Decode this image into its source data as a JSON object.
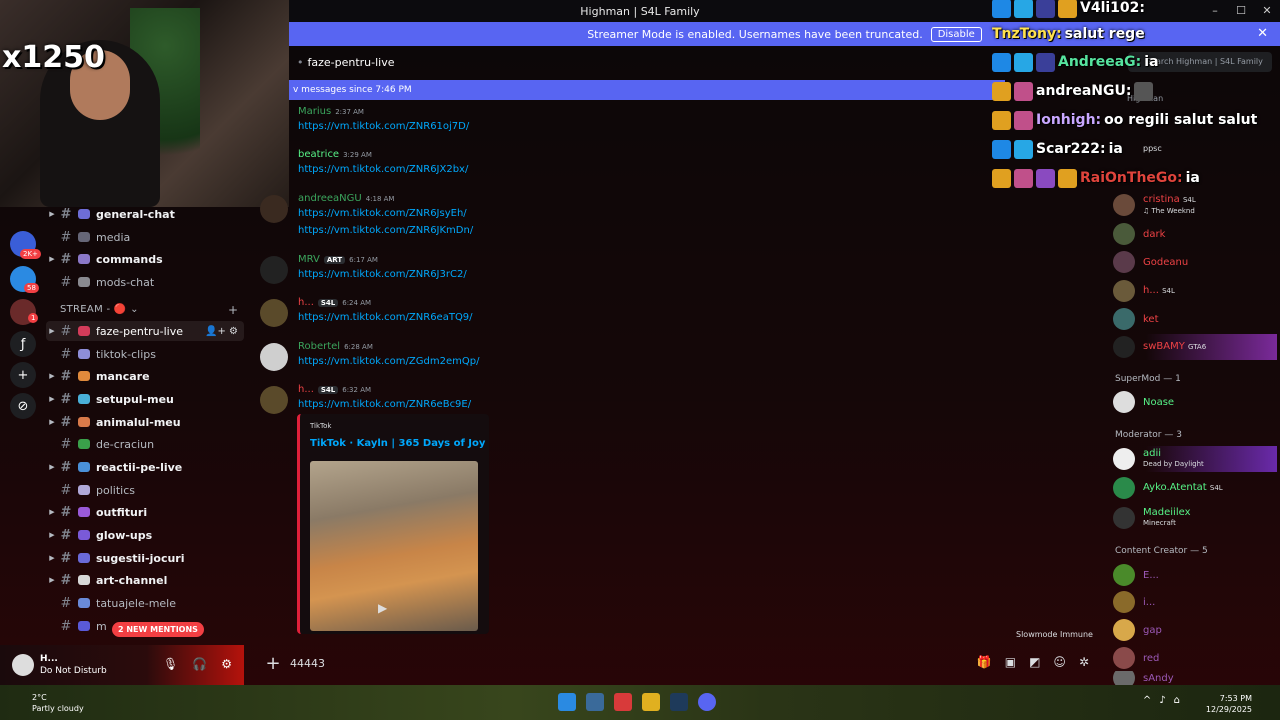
{
  "window": {
    "title": "Highman | S4L Family",
    "controls": [
      "–",
      "☐",
      "✕"
    ]
  },
  "banner": {
    "text": "Streamer Mode is enabled. Usernames have been truncated.",
    "button": "Disable",
    "close": "✕"
  },
  "webcam": {
    "multiplier": "x1250"
  },
  "rail": {
    "badges": [
      "2K+",
      "58",
      "1"
    ]
  },
  "channels": {
    "items_top": [
      {
        "name": "general-chat",
        "bold": true,
        "arrow": true,
        "color": "#6d6dd6"
      },
      {
        "name": "media",
        "bold": false,
        "arrow": false,
        "color": "#666677"
      },
      {
        "name": "commands",
        "bold": true,
        "arrow": true,
        "color": "#8b78c8"
      },
      {
        "name": "mods-chat",
        "bold": false,
        "arrow": false,
        "color": "#8a8a90"
      }
    ],
    "category": "STREAM - 🔴 ⌄",
    "category_plus": "+",
    "items_stream": [
      {
        "name": "faze-pentru-live",
        "bold": false,
        "active": true,
        "arrow": true,
        "color": "#d33c5a"
      },
      {
        "name": "tiktok-clips",
        "bold": false,
        "arrow": false,
        "color": "#8e8ed8"
      },
      {
        "name": "mancare",
        "bold": true,
        "arrow": true,
        "color": "#e08a3c"
      },
      {
        "name": "setupul-meu",
        "bold": true,
        "arrow": true,
        "color": "#4ab0d8"
      },
      {
        "name": "animalul-meu",
        "bold": true,
        "arrow": true,
        "color": "#d87a4a"
      },
      {
        "name": "de-craciun",
        "bold": false,
        "arrow": false,
        "color": "#3aa04a"
      },
      {
        "name": "reactii-pe-live",
        "bold": true,
        "arrow": true,
        "color": "#4a90d8"
      },
      {
        "name": "politics",
        "bold": false,
        "arrow": false,
        "color": "#b0a8d8"
      },
      {
        "name": "outfituri",
        "bold": true,
        "arrow": true,
        "color": "#9a5ad8"
      },
      {
        "name": "glow-ups",
        "bold": true,
        "arrow": true,
        "color": "#7a5ad8"
      },
      {
        "name": "sugestii-jocuri",
        "bold": true,
        "arrow": true,
        "color": "#6a6ad8"
      },
      {
        "name": "art-channel",
        "bold": true,
        "arrow": true,
        "color": "#d8d8d8"
      },
      {
        "name": "tatuajele-mele",
        "bold": false,
        "arrow": false,
        "color": "#6a8ad8"
      },
      {
        "name": "m",
        "bold": false,
        "arrow": false,
        "color": "#5a5ad8"
      }
    ],
    "active_tools": "👤+ ⚙",
    "new_mentions": "2 NEW MENTIONS"
  },
  "user": {
    "name": "H...",
    "status": "Do Not Disturb",
    "controls": [
      "🎙",
      "🎧",
      "⚙"
    ]
  },
  "chat": {
    "channel": "faze-pentru-live",
    "new_messages": "v messages since 7:46 PM",
    "messages": [
      {
        "author": "Marius",
        "color": "#3ba55d",
        "time": "2:37 AM",
        "link": "https://vm.tiktok.com/ZNR61oj7D/",
        "tag": ""
      },
      {
        "author": "beatrice",
        "color": "#57f287",
        "time": "3:29 AM",
        "link": "https://vm.tiktok.com/ZNR6JX2bx/",
        "tag": ""
      },
      {
        "author": "andreeaNGU",
        "color": "#3ba55d",
        "time": "4:18 AM",
        "link": "https://vm.tiktok.com/ZNR6JsyEh/",
        "link2": "https://vm.tiktok.com/ZNR6JKmDn/",
        "tag": ""
      },
      {
        "author": "MRV",
        "color": "#3ba55d",
        "time": "6:17 AM",
        "link": "https://vm.tiktok.com/ZNR6J3rC2/",
        "tag": "ART"
      },
      {
        "author": "h...",
        "color": "#ed4245",
        "time": "6:24 AM",
        "link": "https://vm.tiktok.com/ZNR6eaTQ9/",
        "tag": "S4L"
      },
      {
        "author": "Robertel",
        "color": "#3ba55d",
        "time": "6:28 AM",
        "link": "https://vm.tiktok.com/ZGdm2emQp/",
        "tag": ""
      },
      {
        "author": "h...",
        "color": "#ed4245",
        "time": "6:32 AM",
        "link": "https://vm.tiktok.com/ZNR6eBc9E/",
        "tag": "S4L"
      }
    ],
    "embed": {
      "provider": "TikTok",
      "title": "TikTok · Kayln | 365 Days of Joy"
    },
    "slowmode": "Slowmode Immune",
    "input_value": "44443"
  },
  "search": {
    "placeholder": "Search Highman | S4L Family"
  },
  "members": {
    "top_hidden": "Highman",
    "ppsc": "ppsc",
    "list1": [
      {
        "name": "cristina",
        "sub": "♫ The Weeknd",
        "color": "#ed4245",
        "tag": "S4L"
      },
      {
        "name": "dark",
        "sub": "",
        "color": "#ed4245",
        "tag": ""
      },
      {
        "name": "Godeanu",
        "sub": "",
        "color": "#ed4245",
        "tag": ""
      },
      {
        "name": "h...",
        "sub": "",
        "color": "#ed4245",
        "tag": "S4L"
      },
      {
        "name": "ket",
        "sub": "",
        "color": "#ed4245",
        "tag": ""
      },
      {
        "name": "swBAMY",
        "sub": "",
        "color": "#ed4245",
        "tag": "GTA6"
      }
    ],
    "supermod_label": "SuperMod — 1",
    "supermod": [
      {
        "name": "Noase",
        "sub": "",
        "color": "#57f287",
        "tag": ""
      }
    ],
    "moderator_label": "Moderator — 3",
    "moderators": [
      {
        "name": "adii",
        "sub": "Dead by Daylight",
        "color": "#57f287",
        "tag": ""
      },
      {
        "name": "Ayko.Atentat",
        "sub": "",
        "color": "#57f287",
        "tag": "S4L"
      },
      {
        "name": "Madeiilex",
        "sub": "Minecraft",
        "color": "#57f287",
        "tag": ""
      }
    ],
    "creator_label": "Content Creator — 5",
    "creators": [
      {
        "name": "E...",
        "color": "#9b59b6"
      },
      {
        "name": "i...",
        "color": "#9b59b6"
      },
      {
        "name": "gap",
        "color": "#9b59b6"
      },
      {
        "name": "red",
        "color": "#9b59b6"
      },
      {
        "name": "sAndy",
        "color": "#9b59b6"
      }
    ]
  },
  "overlay": {
    "lines": [
      {
        "name": "V4li102:",
        "msg": "",
        "color": "#ffffff"
      },
      {
        "name": "TnzTony:",
        "msg": "salut rege",
        "color": "#ffe14d"
      },
      {
        "name": "AndreeaG:",
        "msg": "ia",
        "color": "#56e39f"
      },
      {
        "name": "andreaNGU:",
        "msg": "",
        "color": "#ffffff"
      },
      {
        "name": "Ionhigh:",
        "msg": "oo regili salut salut",
        "color": "#c9a7ff"
      },
      {
        "name": "Scar222:",
        "msg": "ia",
        "color": "#ffffff"
      },
      {
        "name": "RaiOnTheGo:",
        "msg": "ia",
        "color": "#e0443c"
      }
    ]
  },
  "taskbar": {
    "temp": "2°C",
    "weather": "Partly cloudy",
    "time": "7:53 PM",
    "date": "12/29/2025"
  }
}
